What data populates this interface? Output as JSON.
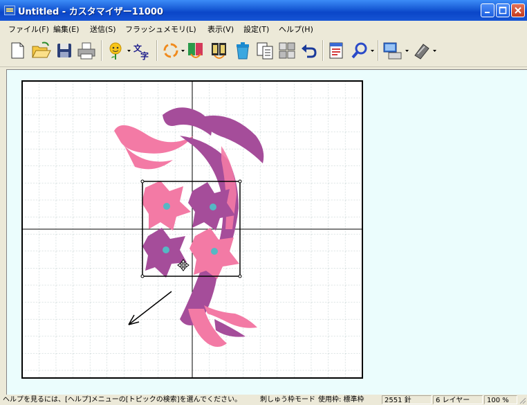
{
  "window": {
    "title": "Untitled - カスタマイザー11000"
  },
  "menu": [
    "ファイル(F)",
    "編集(E)",
    "送信(S)",
    "フラッシュメモリ(L)",
    "表示(V)",
    "設定(T)",
    "ヘルプ(H)"
  ],
  "toolbar": {
    "icons": [
      "new-file-icon",
      "open-folder-icon",
      "save-icon",
      "print-icon",
      "sun-flower-icon",
      "text-tool-icon",
      "rotate-icon",
      "color-order-icon",
      "stitch-order-icon",
      "delete-trash-icon",
      "copy-paste-icon",
      "layout-icon",
      "undo-icon",
      "properties-icon",
      "zoom-icon",
      "transfer-icon",
      "machine-icon"
    ]
  },
  "colors": {
    "hoop": "#000000",
    "grid": "#b0c4c4",
    "ribbon_dark": "#a54d9a",
    "ribbon_light": "#f37aa5",
    "flower_center": "#55b8c4"
  },
  "statusbar": {
    "help": "ヘルプを見るには、[ヘルプ]メニューの[トピックの検索]を選んでください。",
    "mode": "刺しゅう枠モード",
    "hoop": "使用枠: 標準枠",
    "stitches": "2551 針",
    "layers": "6 レイヤー",
    "zoom": "100 %"
  }
}
